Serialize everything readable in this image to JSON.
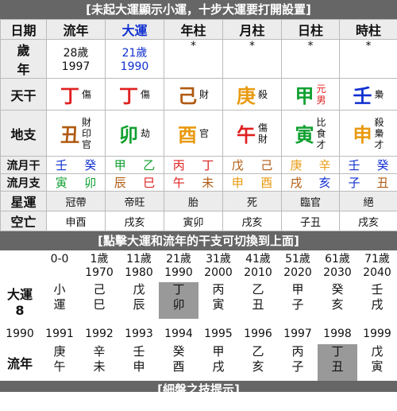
{
  "title": "[未起大運顯示小運，十步大運要打開設置]",
  "headers": [
    "日期",
    "流年",
    "大運",
    "年柱",
    "月柱",
    "日柱",
    "時柱"
  ],
  "age_label": [
    "歲",
    "年"
  ],
  "liunian": {
    "age": "28歲",
    "year": "1997"
  },
  "dayun": {
    "age": "21歲",
    "year": "1990"
  },
  "pillar_marks": [
    "*",
    "*",
    "*",
    "*"
  ],
  "tiangan_label": "天干",
  "tiangan": [
    {
      "char": "丁",
      "color": "#e02020",
      "notes": [
        "傷"
      ]
    },
    {
      "char": "丁",
      "color": "#e02020",
      "notes": [
        "傷"
      ]
    },
    {
      "char": "己",
      "color": "#b05a10",
      "notes": [
        "財"
      ]
    },
    {
      "char": "庚",
      "color": "#e89a10",
      "notes": [
        "殺"
      ]
    },
    {
      "char": "甲",
      "color": "#10a030",
      "notes": [
        "元",
        "男"
      ]
    },
    {
      "char": "壬",
      "color": "#1030d0",
      "notes": [
        "梟"
      ]
    }
  ],
  "dizhi_label": "地支",
  "dizhi": [
    {
      "char": "丑",
      "color": "#b05a10",
      "notes": [
        "財",
        "印",
        "官"
      ]
    },
    {
      "char": "卯",
      "color": "#10a030",
      "notes": [
        "劫"
      ]
    },
    {
      "char": "酉",
      "color": "#e89a10",
      "notes": [
        "官"
      ]
    },
    {
      "char": "午",
      "color": "#e02020",
      "notes": [
        "傷",
        "財"
      ]
    },
    {
      "char": "寅",
      "color": "#10a030",
      "notes": [
        "比",
        "食",
        "才"
      ]
    },
    {
      "char": "申",
      "color": "#e89a10",
      "notes": [
        "殺",
        "梟",
        "才"
      ]
    }
  ],
  "liuyue_gan_label": "流月干",
  "liuyue_gan": [
    {
      "c": "壬",
      "col": "#1030d0"
    },
    {
      "c": "癸",
      "col": "#1030d0"
    },
    {
      "c": "甲",
      "col": "#10a030"
    },
    {
      "c": "乙",
      "col": "#10a030"
    },
    {
      "c": "丙",
      "col": "#e02020"
    },
    {
      "c": "丁",
      "col": "#e02020"
    },
    {
      "c": "戊",
      "col": "#b05a10"
    },
    {
      "c": "己",
      "col": "#b05a10"
    },
    {
      "c": "庚",
      "col": "#e89a10"
    },
    {
      "c": "辛",
      "col": "#e89a10"
    },
    {
      "c": "壬",
      "col": "#1030d0"
    },
    {
      "c": "癸",
      "col": "#1030d0"
    }
  ],
  "liuyue_zhi_label": "流月支",
  "liuyue_zhi": [
    {
      "c": "寅",
      "col": "#10a030"
    },
    {
      "c": "卯",
      "col": "#10a030"
    },
    {
      "c": "辰",
      "col": "#b05a10"
    },
    {
      "c": "巳",
      "col": "#e02020"
    },
    {
      "c": "午",
      "col": "#e02020"
    },
    {
      "c": "未",
      "col": "#b05a10"
    },
    {
      "c": "申",
      "col": "#e89a10"
    },
    {
      "c": "酉",
      "col": "#e89a10"
    },
    {
      "c": "戌",
      "col": "#b05a10"
    },
    {
      "c": "亥",
      "col": "#1030d0"
    },
    {
      "c": "子",
      "col": "#1030d0"
    },
    {
      "c": "丑",
      "col": "#b05a10"
    }
  ],
  "xingyun_label": "星運",
  "xingyun": [
    "冠帶",
    "帝旺",
    "胎",
    "死",
    "臨官",
    "絕"
  ],
  "kongwang_label": "空亡",
  "kongwang": [
    "申酉",
    "戌亥",
    "寅卯",
    "戌亥",
    "子丑",
    "戌亥"
  ],
  "section2_title": "[點擊大運和流年的干支可切換到上面]",
  "dayun_ages": [
    "0-0",
    "1歲",
    "11歲",
    "21歲",
    "31歲",
    "41歲",
    "51歲",
    "61歲",
    "71歲"
  ],
  "dayun_years": [
    "",
    "1970",
    "1980",
    "1990",
    "2000",
    "2010",
    "2020",
    "2030",
    "2040"
  ],
  "dayun_label": "大運",
  "dayun_count": "8",
  "dayun_gz": [
    [
      "小",
      "運"
    ],
    [
      "己",
      "巳"
    ],
    [
      "戊",
      "辰"
    ],
    [
      "丁",
      "卯"
    ],
    [
      "丙",
      "寅"
    ],
    [
      "乙",
      "丑"
    ],
    [
      "甲",
      "子"
    ],
    [
      "癸",
      "亥"
    ],
    [
      "壬",
      "戌"
    ]
  ],
  "liunian_years": [
    "1990",
    "1991",
    "1992",
    "1993",
    "1994",
    "1995",
    "1996",
    "1997",
    "1998",
    "1999"
  ],
  "liunian_label": "流年",
  "liunian_gz": [
    [
      "庚",
      "午"
    ],
    [
      "辛",
      "未"
    ],
    [
      "壬",
      "申"
    ],
    [
      "癸",
      "酉"
    ],
    [
      "甲",
      "戌"
    ],
    [
      "乙",
      "亥"
    ],
    [
      "丙",
      "子"
    ],
    [
      "丁",
      "丑"
    ],
    [
      "戊",
      "寅"
    ],
    [
      "己",
      "卯"
    ]
  ],
  "bottom_title": "[細盤之技提示]"
}
